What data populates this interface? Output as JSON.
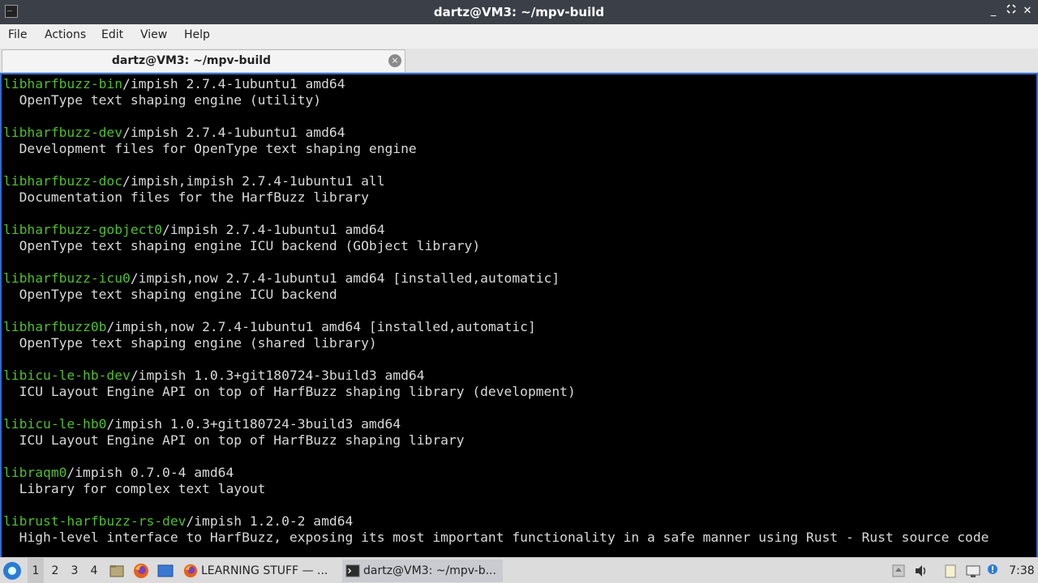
{
  "window": {
    "title": "dartz@VM3: ~/mpv-build",
    "controls": [
      "_",
      "✕"
    ]
  },
  "menubar": [
    "File",
    "Actions",
    "Edit",
    "View",
    "Help"
  ],
  "tab": {
    "label": "dartz@VM3: ~/mpv-build",
    "close_icon": "×"
  },
  "terminal": {
    "lines": [
      {
        "pkg": "libharfbuzz-bin",
        "rest": "/impish 2.7.4-1ubuntu1 amd64"
      },
      {
        "pkg": "",
        "rest": "  OpenType text shaping engine (utility)"
      },
      {
        "pkg": "",
        "rest": ""
      },
      {
        "pkg": "libharfbuzz-dev",
        "rest": "/impish 2.7.4-1ubuntu1 amd64"
      },
      {
        "pkg": "",
        "rest": "  Development files for OpenType text shaping engine"
      },
      {
        "pkg": "",
        "rest": ""
      },
      {
        "pkg": "libharfbuzz-doc",
        "rest": "/impish,impish 2.7.4-1ubuntu1 all"
      },
      {
        "pkg": "",
        "rest": "  Documentation files for the HarfBuzz library"
      },
      {
        "pkg": "",
        "rest": ""
      },
      {
        "pkg": "libharfbuzz-gobject0",
        "rest": "/impish 2.7.4-1ubuntu1 amd64"
      },
      {
        "pkg": "",
        "rest": "  OpenType text shaping engine ICU backend (GObject library)"
      },
      {
        "pkg": "",
        "rest": ""
      },
      {
        "pkg": "libharfbuzz-icu0",
        "rest": "/impish,now 2.7.4-1ubuntu1 amd64 [installed,automatic]"
      },
      {
        "pkg": "",
        "rest": "  OpenType text shaping engine ICU backend"
      },
      {
        "pkg": "",
        "rest": ""
      },
      {
        "pkg": "libharfbuzz0b",
        "rest": "/impish,now 2.7.4-1ubuntu1 amd64 [installed,automatic]"
      },
      {
        "pkg": "",
        "rest": "  OpenType text shaping engine (shared library)"
      },
      {
        "pkg": "",
        "rest": ""
      },
      {
        "pkg": "libicu-le-hb-dev",
        "rest": "/impish 1.0.3+git180724-3build3 amd64"
      },
      {
        "pkg": "",
        "rest": "  ICU Layout Engine API on top of HarfBuzz shaping library (development)"
      },
      {
        "pkg": "",
        "rest": ""
      },
      {
        "pkg": "libicu-le-hb0",
        "rest": "/impish 1.0.3+git180724-3build3 amd64"
      },
      {
        "pkg": "",
        "rest": "  ICU Layout Engine API on top of HarfBuzz shaping library"
      },
      {
        "pkg": "",
        "rest": ""
      },
      {
        "pkg": "libraqm0",
        "rest": "/impish 0.7.0-4 amd64"
      },
      {
        "pkg": "",
        "rest": "  Library for complex text layout"
      },
      {
        "pkg": "",
        "rest": ""
      },
      {
        "pkg": "librust-harfbuzz-rs-dev",
        "rest": "/impish 1.2.0-2 amd64"
      },
      {
        "pkg": "",
        "rest": "  High-level interface to HarfBuzz, exposing its most important functionality in a safe manner using Rust - Rust source code"
      }
    ]
  },
  "taskbar": {
    "workspaces": [
      "1",
      "2",
      "3",
      "4"
    ],
    "active_workspace": "1",
    "tasks": [
      {
        "label": "LEARNING STUFF — ...",
        "icon": "firefox-icon",
        "active": false
      },
      {
        "label": "dartz@VM3: ~/mpv-b...",
        "icon": "terminal-icon",
        "active": true
      }
    ],
    "clock": "7:38"
  },
  "colors": {
    "terminal_bg": "#000000",
    "terminal_fg": "#d8d8d8",
    "package_name": "#4fbf2a",
    "titlebar": "#3b4048",
    "terminal_border": "#2f6bd1"
  }
}
